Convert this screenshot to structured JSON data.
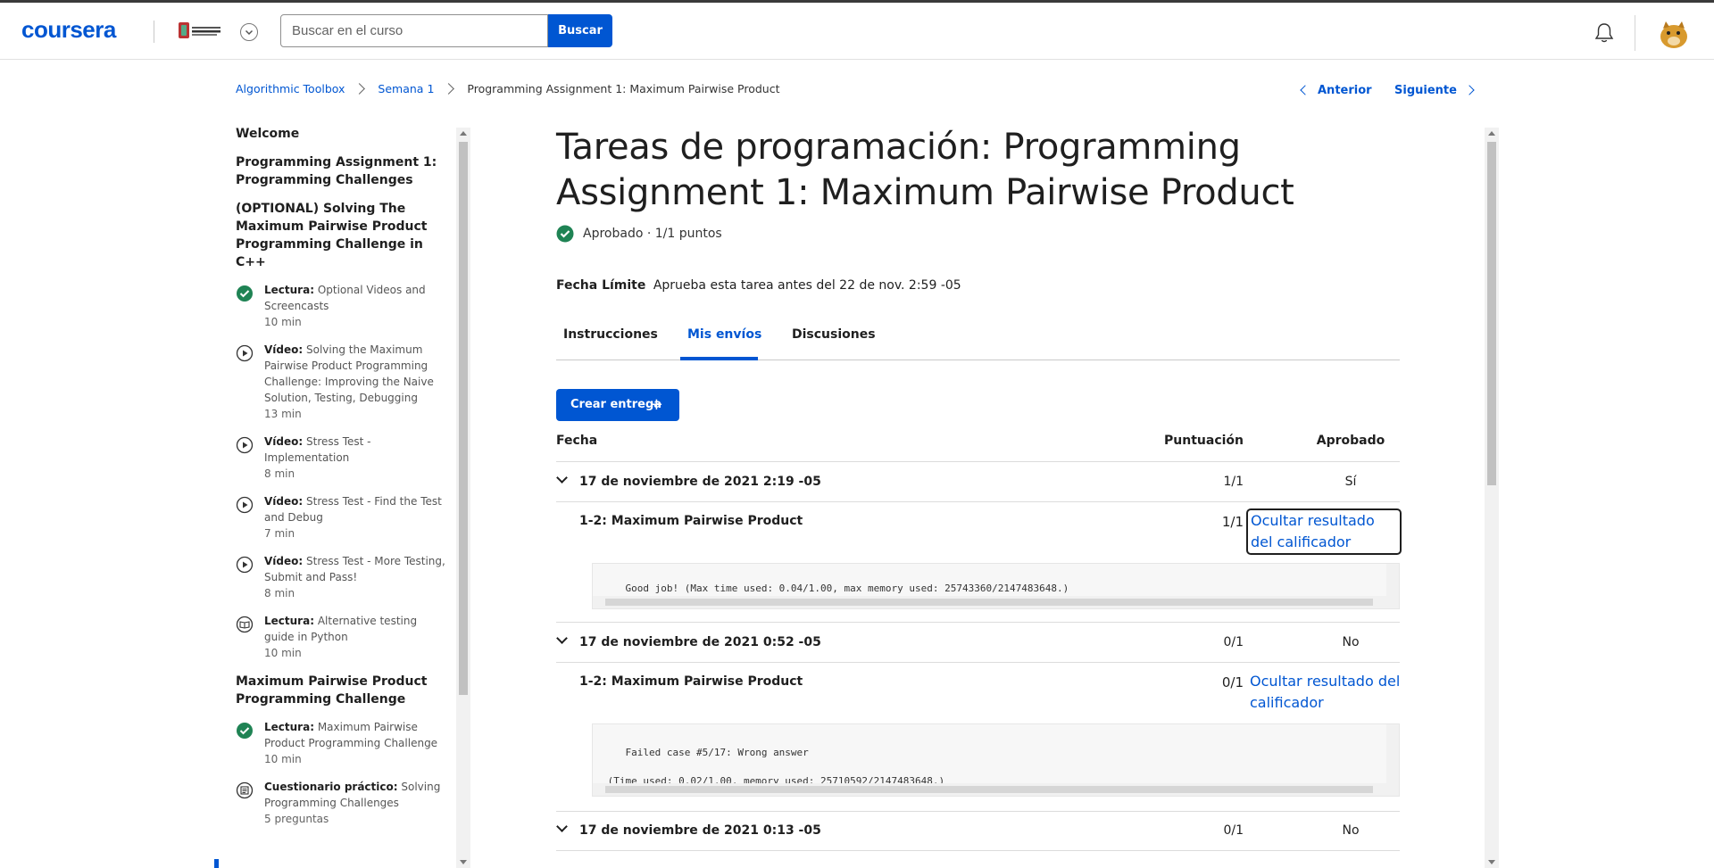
{
  "header": {
    "logo": "coursera",
    "search_placeholder": "Buscar en el curso",
    "search_button": "Buscar"
  },
  "breadcrumb": [
    "Algorithmic Toolbox",
    "Semana 1",
    "Programming Assignment 1: Maximum Pairwise Product"
  ],
  "nav": {
    "prev": "Anterior",
    "next": "Siguiente"
  },
  "sidebar": {
    "sections": [
      "Welcome",
      "Programming Assignment 1: Programming Challenges",
      "(OPTIONAL) Solving The Maximum Pairwise Product Programming Challenge in C++",
      "Maximum Pairwise Product Programming Challenge"
    ],
    "items": [
      {
        "type": "Lectura:",
        "title": "Optional Videos and Screencasts",
        "duration": "10 min",
        "icon": "check-circle-icon"
      },
      {
        "type": "Vídeo:",
        "title": "Solving the Maximum Pairwise Product Programming Challenge: Improving the Naive Solution, Testing, Debugging",
        "duration": "13 min",
        "icon": "play-icon"
      },
      {
        "type": "Vídeo:",
        "title": "Stress Test - Implementation",
        "duration": "8 min",
        "icon": "play-icon"
      },
      {
        "type": "Vídeo:",
        "title": "Stress Test - Find the Test and Debug",
        "duration": "7 min",
        "icon": "play-icon"
      },
      {
        "type": "Vídeo:",
        "title": "Stress Test - More Testing, Submit and Pass!",
        "duration": "8 min",
        "icon": "play-icon"
      },
      {
        "type": "Lectura:",
        "title": "Alternative testing guide in Python",
        "duration": "10 min",
        "icon": "book-icon"
      },
      {
        "type": "Lectura:",
        "title": "Maximum Pairwise Product Programming Challenge",
        "duration": "10 min",
        "icon": "check-circle-icon"
      },
      {
        "type": "Cuestionario práctico:",
        "title": "Solving Programming Challenges",
        "duration": "5 preguntas",
        "icon": "quiz-icon"
      }
    ]
  },
  "main": {
    "title": "Tareas de programación: Programming Assignment 1: Maximum Pairwise Product",
    "status": "Aprobado · 1/1 puntos",
    "due_label": "Fecha Límite",
    "due_text": "Aprueba esta tarea antes del 22 de nov. 2:59 -05",
    "tabs": [
      "Instrucciones",
      "Mis envíos",
      "Discusiones"
    ],
    "create_button": "Crear entrega",
    "table_headers": [
      "Fecha",
      "Puntuación",
      "Aprobado"
    ],
    "submissions": [
      {
        "date": "17 de noviembre de 2021 2:19 -05",
        "score": "1/1",
        "passed": "Sí",
        "part": "1-2: Maximum Pairwise Product",
        "part_score": "1/1",
        "link": "Ocultar resultado del calificador",
        "output": "Good job! (Max time used: 0.04/1.00, max memory used: 25743360/2147483648.)"
      },
      {
        "date": "17 de noviembre de 2021 0:52 -05",
        "score": "0/1",
        "passed": "No",
        "part": "1-2: Maximum Pairwise Product",
        "part_score": "0/1",
        "link": "Ocultar resultado del calificador",
        "output": "Failed case #5/17: Wrong answer\n\n (Time used: 0.02/1.00, memory used: 25710592/2147483648.)"
      },
      {
        "date": "17 de noviembre de 2021 0:13 -05",
        "score": "0/1",
        "passed": "No"
      }
    ]
  },
  "colors": {
    "accent": "#0056d2",
    "success": "#1f8354"
  }
}
